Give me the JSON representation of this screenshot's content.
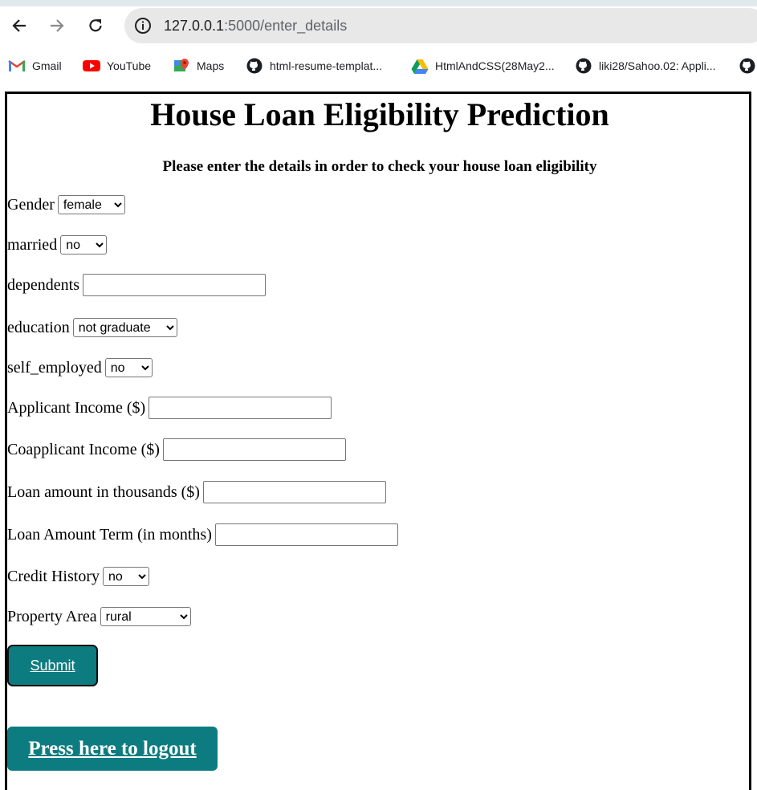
{
  "browser": {
    "url_host": "127.0.0.1",
    "url_path": ":5000/enter_details",
    "bookmarks": [
      "Gmail",
      "YouTube",
      "Maps",
      "html-resume-templat...",
      "HtmlAndCSS(28May2...",
      "liki28/Sahoo.02: Appli..."
    ]
  },
  "page": {
    "title": "House Loan Eligibility Prediction",
    "subtitle": "Please enter the details in order to check your house loan eligibility",
    "fields": {
      "gender": {
        "label": "Gender",
        "value": "female"
      },
      "married": {
        "label": "married",
        "value": "no"
      },
      "dependents": {
        "label": "dependents",
        "value": ""
      },
      "education": {
        "label": "education",
        "value": "not graduate"
      },
      "self_employed": {
        "label": "self_employed",
        "value": "no"
      },
      "applicant_income": {
        "label": "Applicant Income ($)",
        "value": ""
      },
      "coapplicant_income": {
        "label": "Coapplicant Income ($)",
        "value": ""
      },
      "loan_amount": {
        "label": "Loan amount in thousands ($)",
        "value": ""
      },
      "loan_term": {
        "label": "Loan Amount Term (in months)",
        "value": ""
      },
      "credit_history": {
        "label": "Credit History",
        "value": "no"
      },
      "property_area": {
        "label": "Property Area",
        "value": "rural"
      }
    },
    "submit_label": "Submit",
    "logout_label": "Press here to logout"
  },
  "colors": {
    "button": "#0d7c80"
  }
}
